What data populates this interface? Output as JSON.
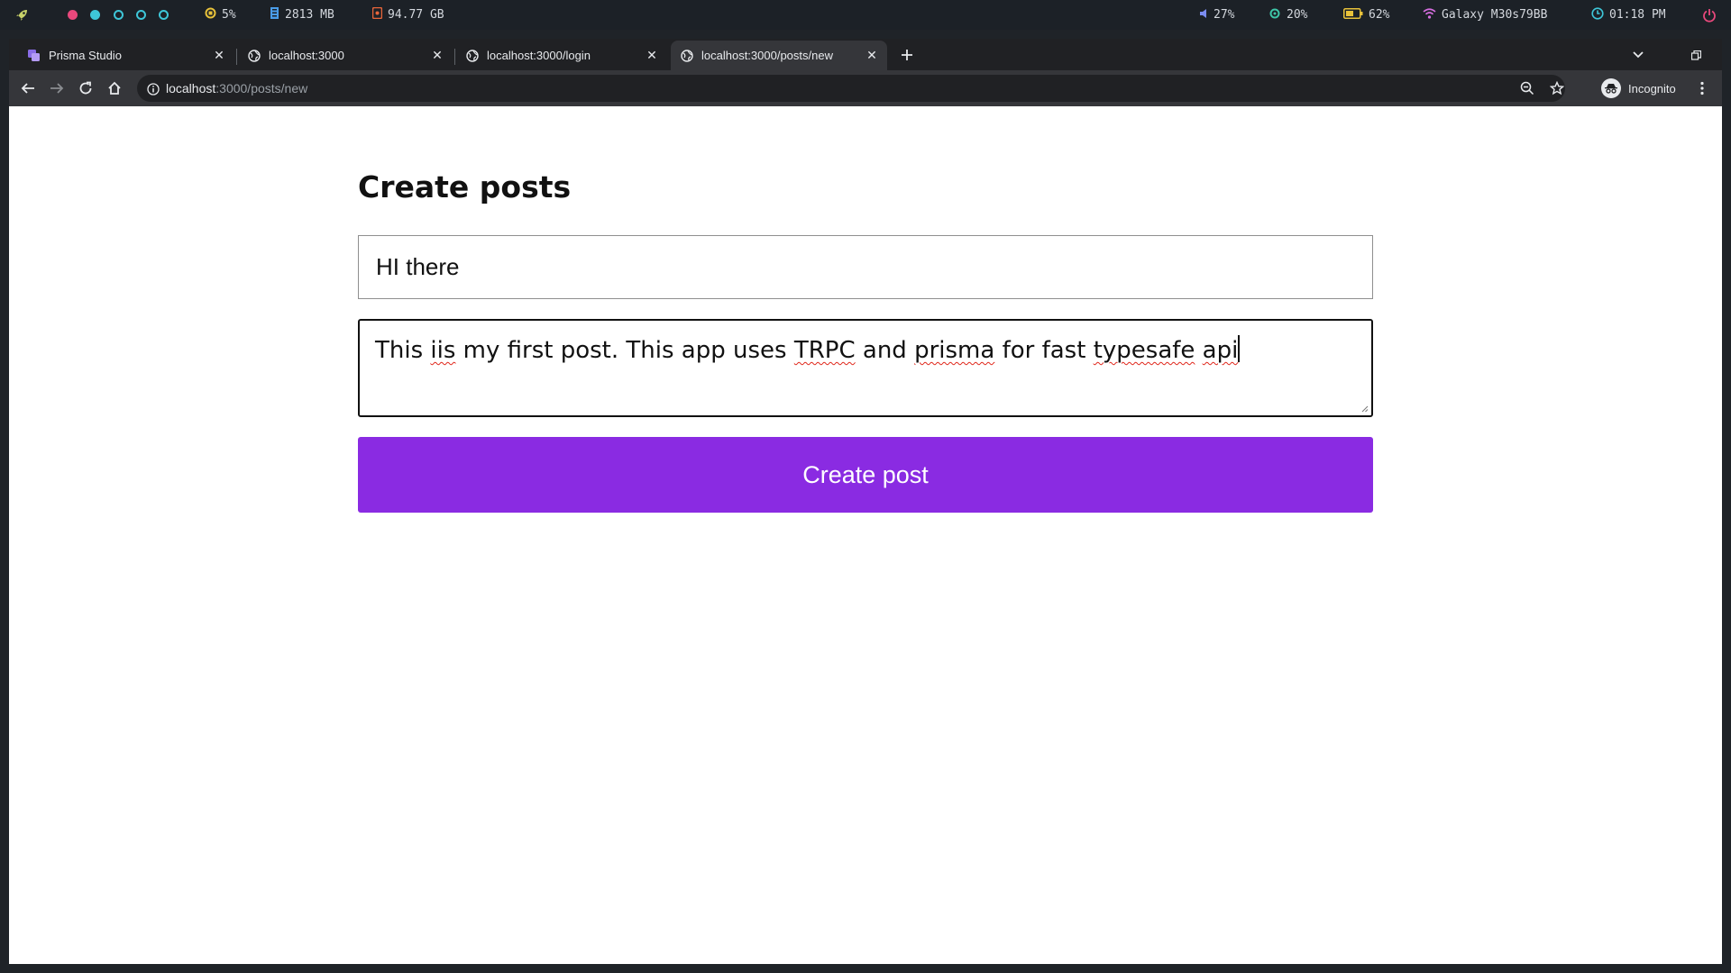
{
  "sysbar": {
    "cpu": "5%",
    "memory": "2813 MB",
    "disk": "94.77 GB",
    "volume": "27%",
    "brightness": "20%",
    "battery": "62%",
    "wifi": "Galaxy M30s79BB",
    "clock": "01:18 PM"
  },
  "tabs": [
    {
      "label": "Prisma Studio",
      "icon": "prisma-icon"
    },
    {
      "label": "localhost:3000",
      "icon": "globe-icon"
    },
    {
      "label": "localhost:3000/login",
      "icon": "globe-icon"
    },
    {
      "label": "localhost:3000/posts/new",
      "icon": "globe-icon",
      "active": true
    }
  ],
  "address": {
    "host": "localhost",
    "path": ":3000/posts/new"
  },
  "profile": {
    "label": "Incognito"
  },
  "page": {
    "heading": "Create posts",
    "title_value": "HI there",
    "content_words": [
      "This",
      "iis",
      "my first post. This app uses",
      "TRPC",
      "and",
      "prisma",
      "for fast",
      "typesafe",
      "api"
    ],
    "button_label": "Create post"
  },
  "colors": {
    "accent": "#8a2be2",
    "spellcheck": "#e0261a"
  }
}
